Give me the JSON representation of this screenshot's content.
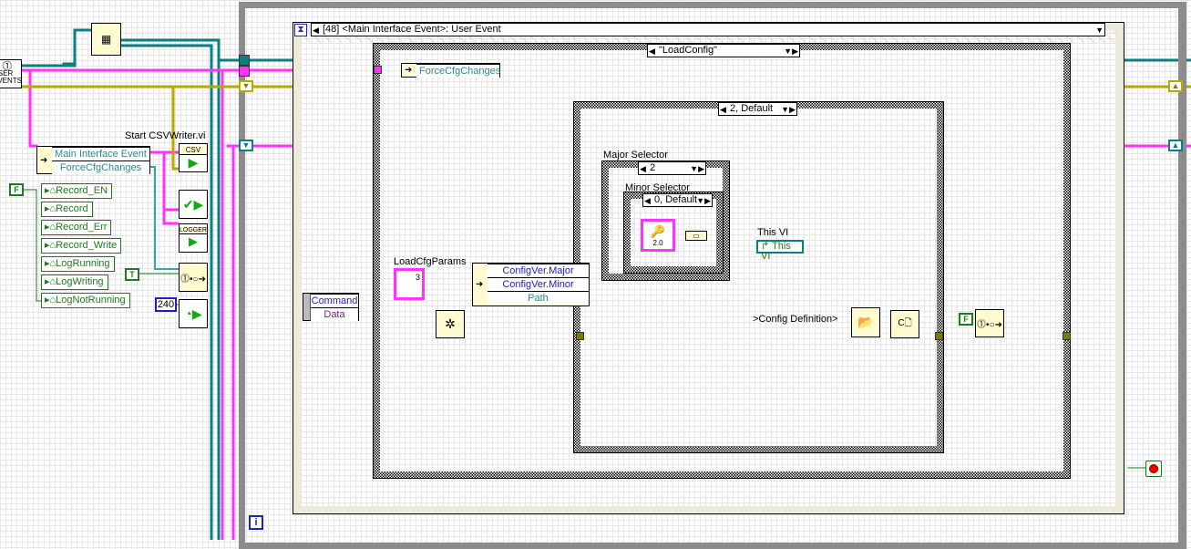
{
  "colors": {
    "cluster": "#ff33ff",
    "refnum": "#0a8080",
    "error": "#c8b400",
    "path": "#33aaaa",
    "enum": "#2020c0",
    "variant": "#7a1a7a",
    "bool": "#1e7a1e"
  },
  "left": {
    "user_events_label": "USER EVENTS",
    "unbundle": [
      "Main Interface Event",
      "ForceCfgChanges"
    ],
    "start_csv_label": "Start CSVWriter.vi",
    "csv_icon_text": "CSV",
    "logger_icon_text": "LOGGER",
    "false_const": "F",
    "true_const": "T",
    "timeout_const": "240",
    "globals": [
      "Record_EN",
      "Record",
      "Record_Err",
      "Record_Write",
      "LogRunning",
      "LogWriting",
      "LogNotRunning"
    ]
  },
  "event_structure": {
    "selector": "[48] <Main Interface Event>: User Event"
  },
  "case_loadconfig": {
    "selector": "\"LoadConfig\"",
    "unbundle_label": "ForceCfgChanges"
  },
  "case_default": {
    "selector": "2, Default"
  },
  "command_unbundle": [
    "Command",
    "Data"
  ],
  "loadcfgparams_label": "LoadCfgParams",
  "loadcfgparams_value": "3",
  "configver_unbundle": [
    "ConfigVer.Major",
    "ConfigVer.Minor",
    "Path"
  ],
  "major_selector": {
    "label": "Major Selector",
    "value": "2"
  },
  "minor_selector": {
    "label": "Minor Selector",
    "value": "0, Default"
  },
  "version_icon_text": "2.0",
  "this_vi": {
    "label": "This VI",
    "value": "This VI"
  },
  "config_def_label": ">Config Definition>",
  "right": {
    "false_const": "F"
  },
  "loop_iteration": "i"
}
